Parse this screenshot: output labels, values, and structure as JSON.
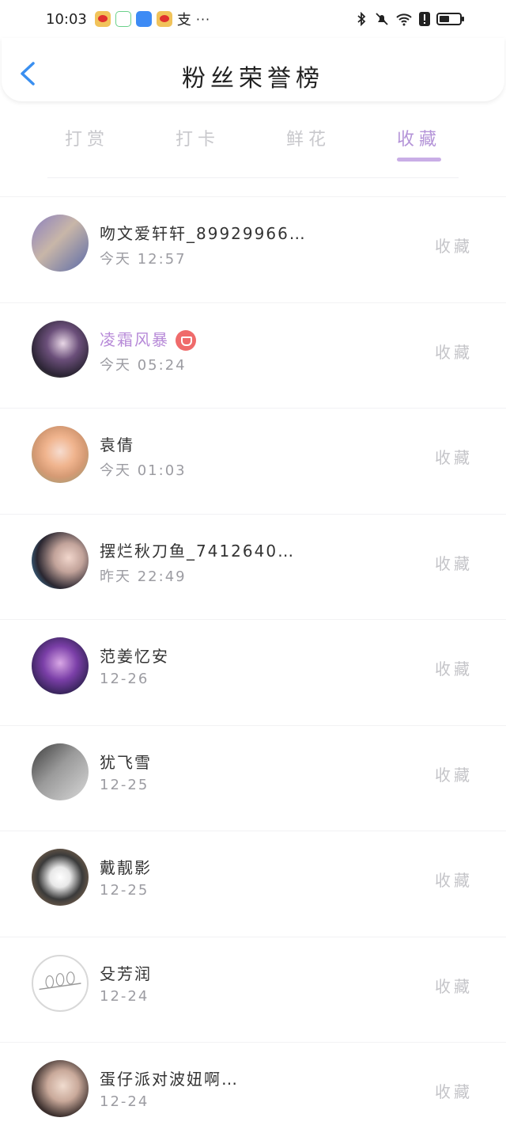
{
  "status_bar": {
    "time": "10:03",
    "zhi": "支",
    "more": "···"
  },
  "header": {
    "title": "粉丝荣誉榜"
  },
  "tabs": [
    {
      "label": "打赏"
    },
    {
      "label": "打卡"
    },
    {
      "label": "鲜花"
    },
    {
      "label": "收藏"
    }
  ],
  "active_tab": "收藏",
  "accent_color": "#b494d8",
  "fans": [
    {
      "name": "吻文爱轩轩_89929966…",
      "time": "今天 12:57",
      "action": "收藏"
    },
    {
      "name": "凌霜风暴",
      "time": "今天 05:24",
      "action": "收藏",
      "vip": true
    },
    {
      "name": "袁倩",
      "time": "今天 01:03",
      "action": "收藏"
    },
    {
      "name": "摆烂秋刀鱼_7412640…",
      "time": "昨天 22:49",
      "action": "收藏"
    },
    {
      "name": "范姜忆安",
      "time": "12-26",
      "action": "收藏"
    },
    {
      "name": "犹飞雪",
      "time": "12-25",
      "action": "收藏"
    },
    {
      "name": "戴靓影",
      "time": "12-25",
      "action": "收藏"
    },
    {
      "name": "殳芳润",
      "time": "12-24",
      "action": "收藏"
    },
    {
      "name": "蛋仔派对波妞啊…",
      "time": "12-24",
      "action": "收藏"
    }
  ]
}
